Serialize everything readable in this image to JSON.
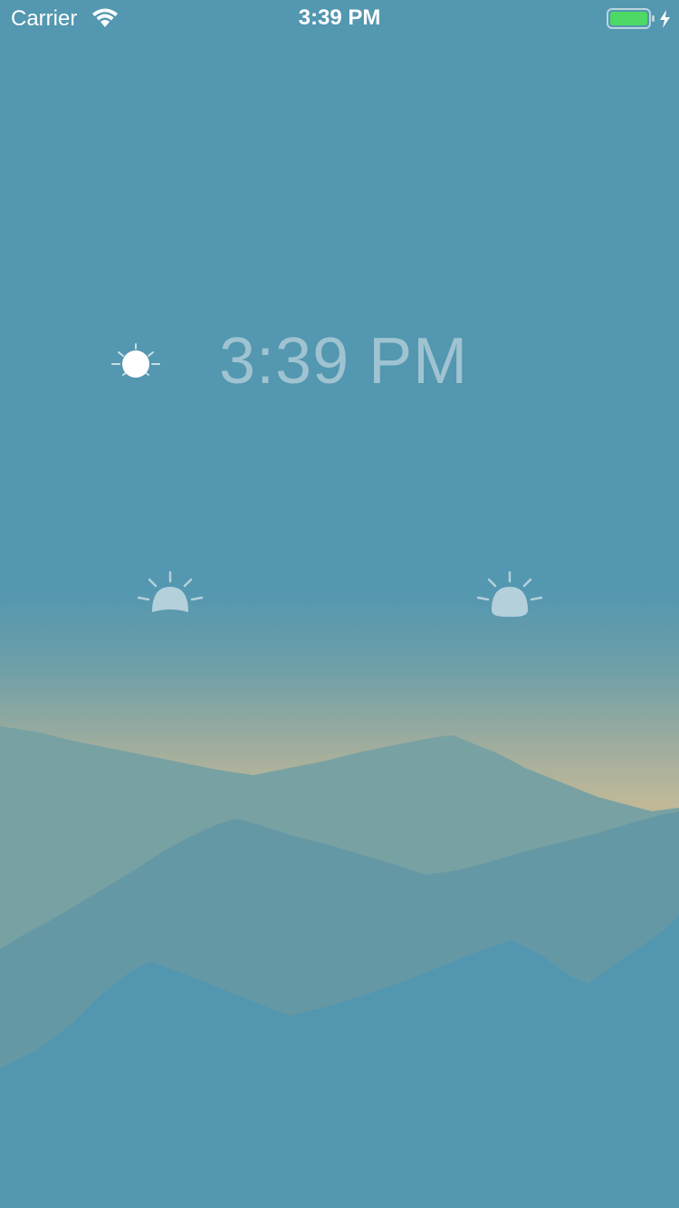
{
  "status_bar": {
    "carrier": "Carrier",
    "time": "3:39 PM",
    "icons": [
      "wifi-icon",
      "battery-charging-icon"
    ],
    "battery_color": "#4cd964"
  },
  "clock": {
    "time": "3:39 PM",
    "current_icon": "sun-icon",
    "sunrise_icon": "sunrise-icon",
    "sunset_icon": "sunset-icon"
  },
  "colors": {
    "background": "#5397b0",
    "horizon_glow": "#c1b998",
    "clock_text": "#9fc3d1",
    "icon_fill": "#b4d0db"
  }
}
